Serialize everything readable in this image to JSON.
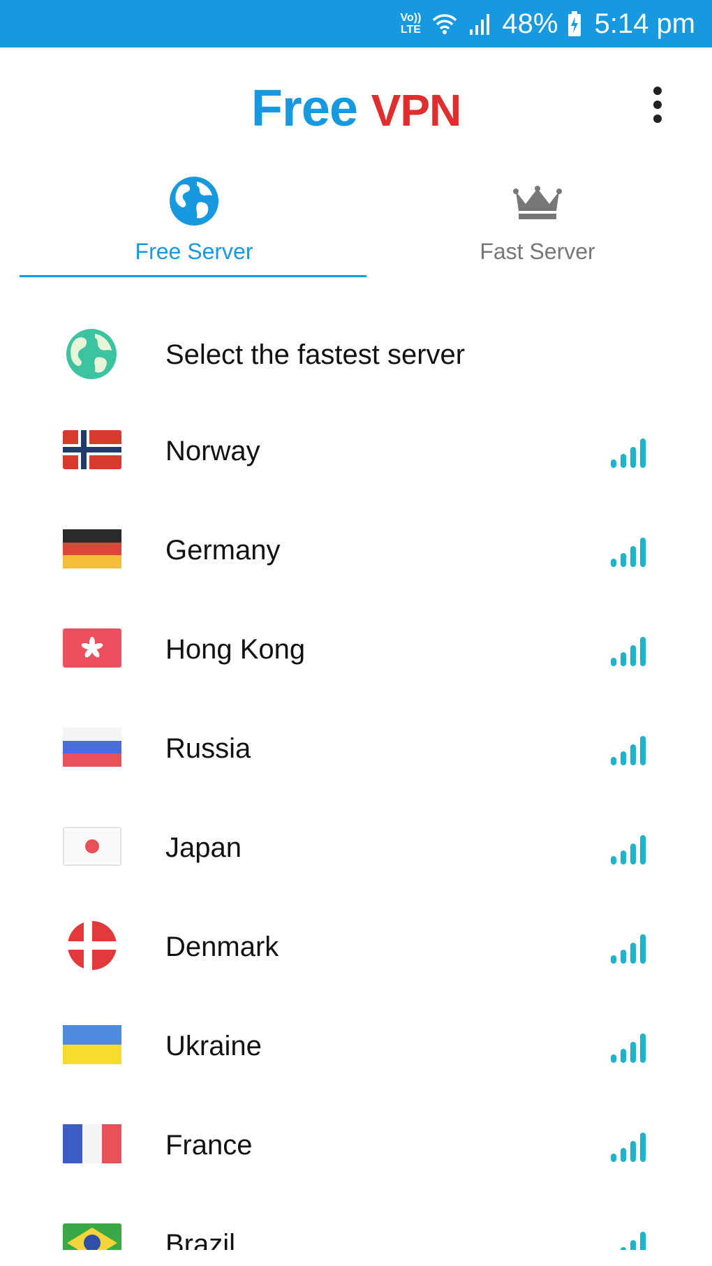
{
  "status_bar": {
    "network": "VoLTE",
    "battery": "48%",
    "time": "5:14 pm"
  },
  "app": {
    "title_part1": "Free",
    "title_part2": "VPN",
    "menu_icon": "more-vertical-icon"
  },
  "tabs": [
    {
      "label": "Free Server",
      "icon": "globe-icon",
      "active": true
    },
    {
      "label": "Fast Server",
      "icon": "crown-icon",
      "active": false
    }
  ],
  "servers": {
    "fastest_label": "Select the fastest server",
    "items": [
      {
        "country": "Norway"
      },
      {
        "country": "Germany"
      },
      {
        "country": "Hong Kong"
      },
      {
        "country": "Russia"
      },
      {
        "country": "Japan"
      },
      {
        "country": "Denmark"
      },
      {
        "country": "Ukraine"
      },
      {
        "country": "France"
      },
      {
        "country": "Brazil"
      }
    ]
  },
  "colors": {
    "accent": "#1799e0",
    "brand_red": "#e02d2d",
    "signal": "#1cb4cc"
  }
}
